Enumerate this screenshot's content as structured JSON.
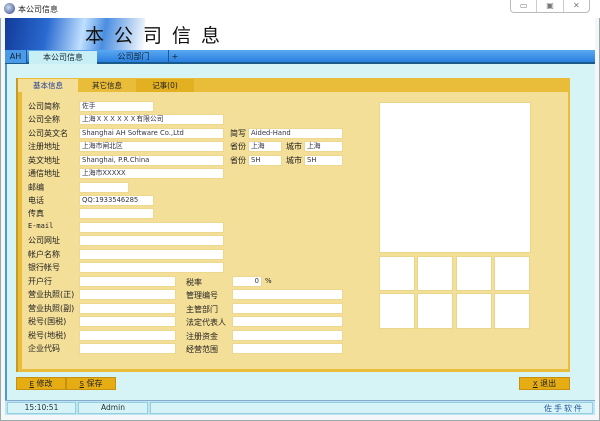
{
  "window": {
    "title": "本公司信息",
    "controls": [
      "▭",
      "▣",
      "✕"
    ]
  },
  "banner": {
    "title": "本公司信息"
  },
  "main_tabs": [
    {
      "label": "AH"
    },
    {
      "label": "本公司信息"
    },
    {
      "label": "公司部门"
    },
    {
      "label": "+"
    }
  ],
  "sub_tabs": [
    {
      "label": "基本信息"
    },
    {
      "label": "其它信息"
    },
    {
      "label": "记事(0)"
    }
  ],
  "form": {
    "short_name": {
      "label": "公司简称",
      "value": "佐手"
    },
    "full_name": {
      "label": "公司全称",
      "value": "上海ＸＸＸＸＸＸ有限公司"
    },
    "english_name": {
      "label": "公司英文名",
      "value": "Shanghai AH Software Co.,Ltd"
    },
    "abbr": {
      "label": "简写",
      "value": "Aided-Hand"
    },
    "reg_address": {
      "label": "注册地址",
      "value": "上海市闸北区"
    },
    "reg_province": {
      "label": "省份",
      "value": "上海"
    },
    "reg_city": {
      "label": "城市",
      "value": "上海"
    },
    "en_address": {
      "label": "英文地址",
      "value": "Shanghai, P.R.China"
    },
    "en_province": {
      "label": "省份",
      "value": "SH"
    },
    "en_city": {
      "label": "城市",
      "value": "SH"
    },
    "mail_address": {
      "label": "通信地址",
      "value": "上海市XXXXX"
    },
    "postcode": {
      "label": "邮编",
      "value": ""
    },
    "phone": {
      "label": "电话",
      "value": "QQ:1933546285"
    },
    "fax": {
      "label": "传真",
      "value": ""
    },
    "email": {
      "label": "E-mail",
      "value": ""
    },
    "website": {
      "label": "公司网址",
      "value": ""
    },
    "account_name": {
      "label": "帐户名称",
      "value": ""
    },
    "bank_account": {
      "label": "银行帐号",
      "value": ""
    },
    "bank": {
      "label": "开户行",
      "value": ""
    },
    "license_main": {
      "label": "营业执照(正)",
      "value": ""
    },
    "license_copy": {
      "label": "营业执照(副)",
      "value": ""
    },
    "tax_national": {
      "label": "税号(国税)",
      "value": ""
    },
    "tax_local": {
      "label": "税号(地税)",
      "value": ""
    },
    "enterprise_code": {
      "label": "企业代码",
      "value": ""
    },
    "tax_rate": {
      "label": "税率",
      "value": "0",
      "unit": "%"
    },
    "mgmt_no": {
      "label": "管理编号",
      "value": ""
    },
    "supervisor": {
      "label": "主管部门",
      "value": ""
    },
    "legal_rep": {
      "label": "法定代表人",
      "value": ""
    },
    "capital": {
      "label": "注册资金",
      "value": ""
    },
    "scope": {
      "label": "经营范围",
      "value": ""
    }
  },
  "buttons": {
    "edit": {
      "key": "E",
      "label": "修改"
    },
    "save": {
      "key": "S",
      "label": "保存"
    },
    "exit": {
      "key": "X",
      "label": "退出"
    }
  },
  "status": {
    "time": "15:10:51",
    "user": "Admin",
    "brand": "佐手软件"
  }
}
